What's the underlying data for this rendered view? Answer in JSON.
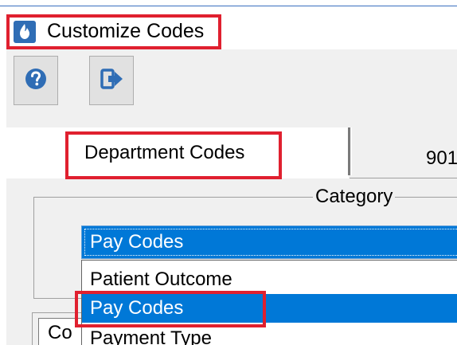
{
  "window": {
    "title": "Customize Codes"
  },
  "toolbar": {
    "help_icon": "help-circle-icon",
    "exit_icon": "exit-arrow-icon"
  },
  "tabs": [
    {
      "label": "Department Codes"
    },
    {
      "label": "901"
    }
  ],
  "category": {
    "legend": "Category",
    "selected_value": "Pay Codes",
    "options": [
      {
        "label": "Patient Outcome"
      },
      {
        "label": "Pay Codes"
      },
      {
        "label": "Payment Type"
      }
    ]
  },
  "lower_panel": {
    "label": "Co"
  },
  "colors": {
    "selection": "#0078d7",
    "highlight": "#e0202f",
    "app_icon": "#2f6db5"
  }
}
